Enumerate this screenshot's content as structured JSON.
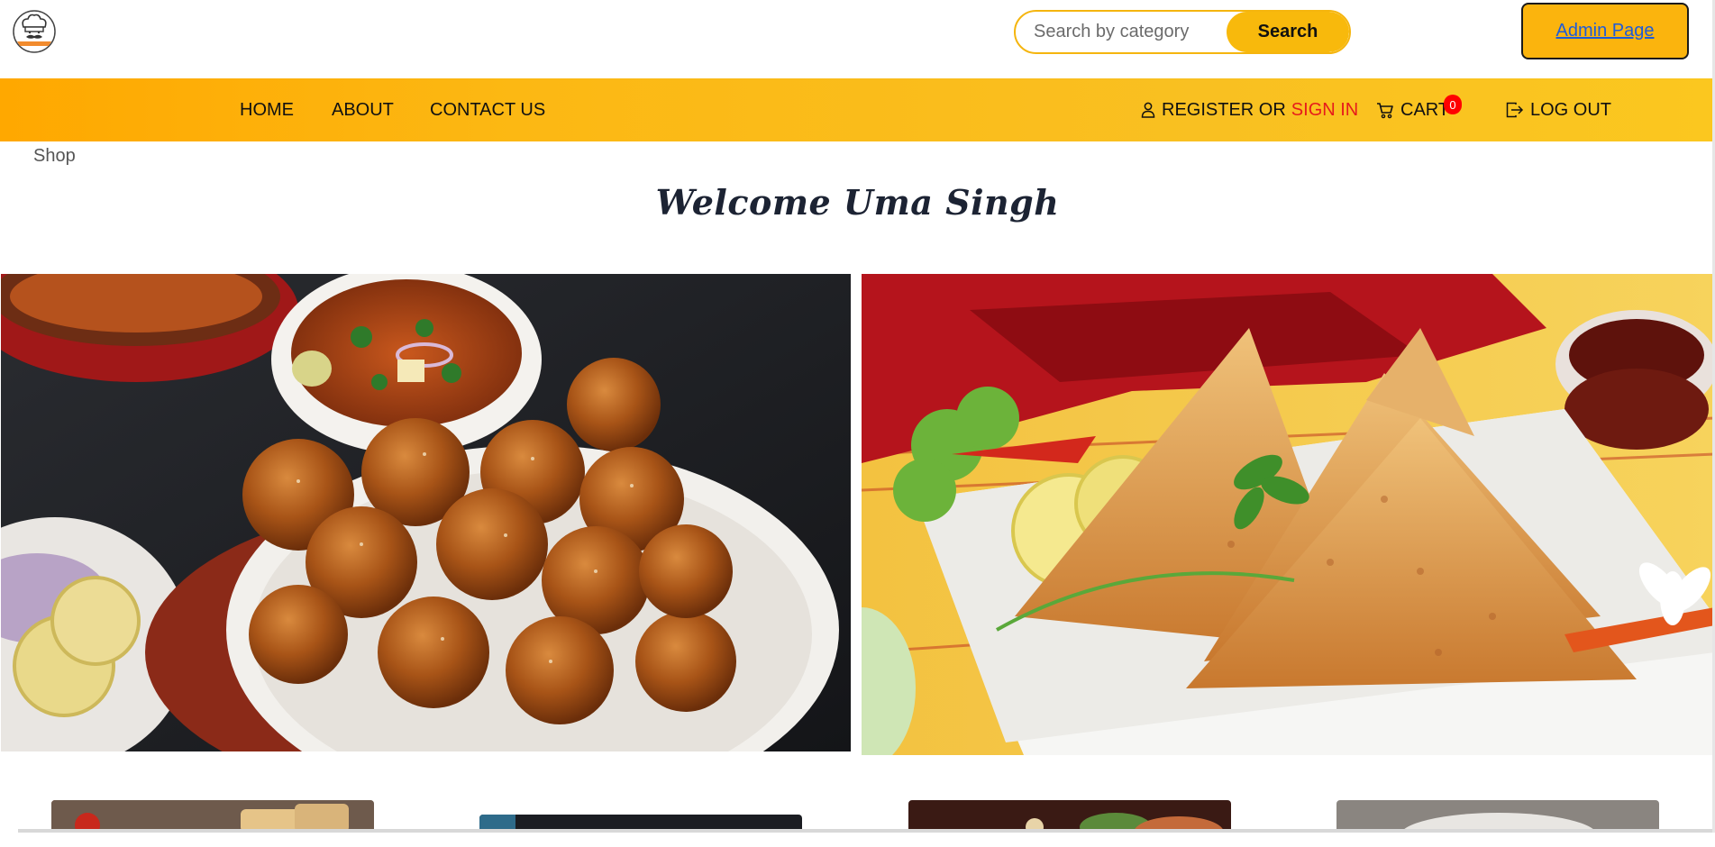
{
  "header": {
    "logo_icon": "chef-hat-logo-icon",
    "search": {
      "placeholder": "Search by category",
      "value": "",
      "button_label": "Search"
    },
    "admin_label": "Admin Page"
  },
  "nav": {
    "links": [
      {
        "label": "HOME"
      },
      {
        "label": "ABOUT"
      },
      {
        "label": "CONTACT US"
      }
    ],
    "register_label": "REGISTER OR",
    "signin_label": "SIGN IN",
    "cart_label": "CART",
    "cart_count": "0",
    "logout_label": "LOG OUT"
  },
  "breadcrumb": "Shop",
  "welcome_text": "Welcome Uma Singh",
  "colors": {
    "accent": "#fbb40d",
    "signin": "#e61b1b",
    "badge": "#ff0000",
    "admin_link": "#1e5bd8"
  }
}
